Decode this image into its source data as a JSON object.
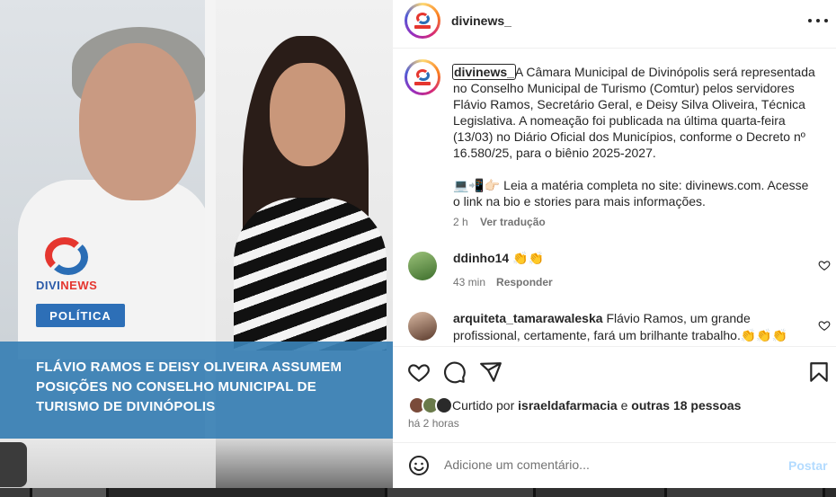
{
  "post": {
    "username": "divinews_",
    "image": {
      "logo_text_a": "DIVI",
      "logo_text_b": "NEWS",
      "tag": "POLÍTICA",
      "headline": "FLÁVIO RAMOS E DEISY OLIVEIRA ASSUMEM POSIÇÕES NO CONSELHO MUNICIPAL DE TURISMO DE DIVINÓPOLIS"
    },
    "caption_username": "divinews_",
    "caption_p1": "A Câmara Municipal de Divinópolis será representada no Conselho Municipal de Turismo (Comtur) pelos servidores Flávio Ramos, Secretário Geral, e Deisy Silva Oliveira, Técnica Legislativa. A nomeação foi publicada na última quarta-feira (13/03) no Diário Oficial dos Municípios, conforme o Decreto nº 16.580/25, para o biênio 2025-2027.",
    "caption_p2": "💻📲👉🏻 Leia a matéria completa no site: divinews.com. Acesse o link na bio e stories para mais informações.",
    "caption_time": "2 h",
    "translate_label": "Ver tradução"
  },
  "comments": [
    {
      "user": "ddinho14",
      "text": "👏👏",
      "time": "43 min",
      "reply": "Responder",
      "avatar_color": "#4f8a3c"
    },
    {
      "user": "arquiteta_tamarawaleska",
      "text": "Flávio Ramos, um grande profissional, certamente, fará um brilhante trabalho.👏👏👏",
      "avatar_color": "#6b4a3a"
    }
  ],
  "likes": {
    "prefix": "Curtido por",
    "user": "israeldafarmacia",
    "conj": "e",
    "others": "outras 18 pessoas",
    "avatar_colors": [
      "#7a4b3a",
      "#6a7a4a",
      "#2a2a2a"
    ]
  },
  "posted_when": "há 2 horas",
  "add_comment": {
    "placeholder": "Adicione um comentário...",
    "post_label": "Postar"
  },
  "icons": [
    "like-icon",
    "comment-icon",
    "share-icon",
    "save-icon",
    "more-icon",
    "emoji-icon",
    "heart-small-icon"
  ]
}
